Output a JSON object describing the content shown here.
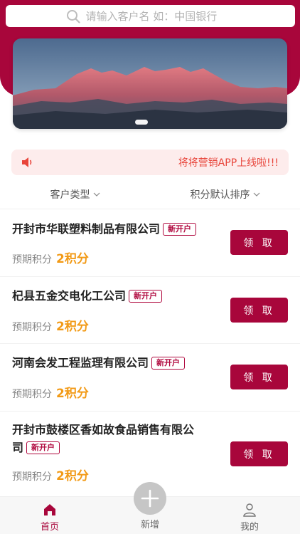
{
  "search": {
    "placeholder": "请输入客户名 如：中国银行"
  },
  "notice": {
    "text": "将将营销APP上线啦!!!"
  },
  "filters": [
    {
      "label": "客户类型"
    },
    {
      "label": "积分默认排序"
    }
  ],
  "customers": [
    {
      "name": "开封市华联塑料制品有限公司",
      "tag": "新开户",
      "points_label": "预期积分",
      "points_value": "2积分",
      "button": "领 取"
    },
    {
      "name": "杞县五金交电化工公司",
      "tag": "新开户",
      "points_label": "预期积分",
      "points_value": "2积分",
      "button": "领 取"
    },
    {
      "name": "河南会发工程监理有限公司",
      "tag": "新开户",
      "points_label": "预期积分",
      "points_value": "2积分",
      "button": "领 取"
    },
    {
      "name": "开封市鼓楼区香如故食品销售有限公司",
      "tag": "新开户",
      "points_label": "预期积分",
      "points_value": "2积分",
      "button": "领 取"
    }
  ],
  "tabbar": {
    "home": "首页",
    "add": "新增",
    "mine": "我的"
  },
  "colors": {
    "brand": "#a8063b",
    "points": "#f29a16",
    "notice": "#e8443a"
  }
}
